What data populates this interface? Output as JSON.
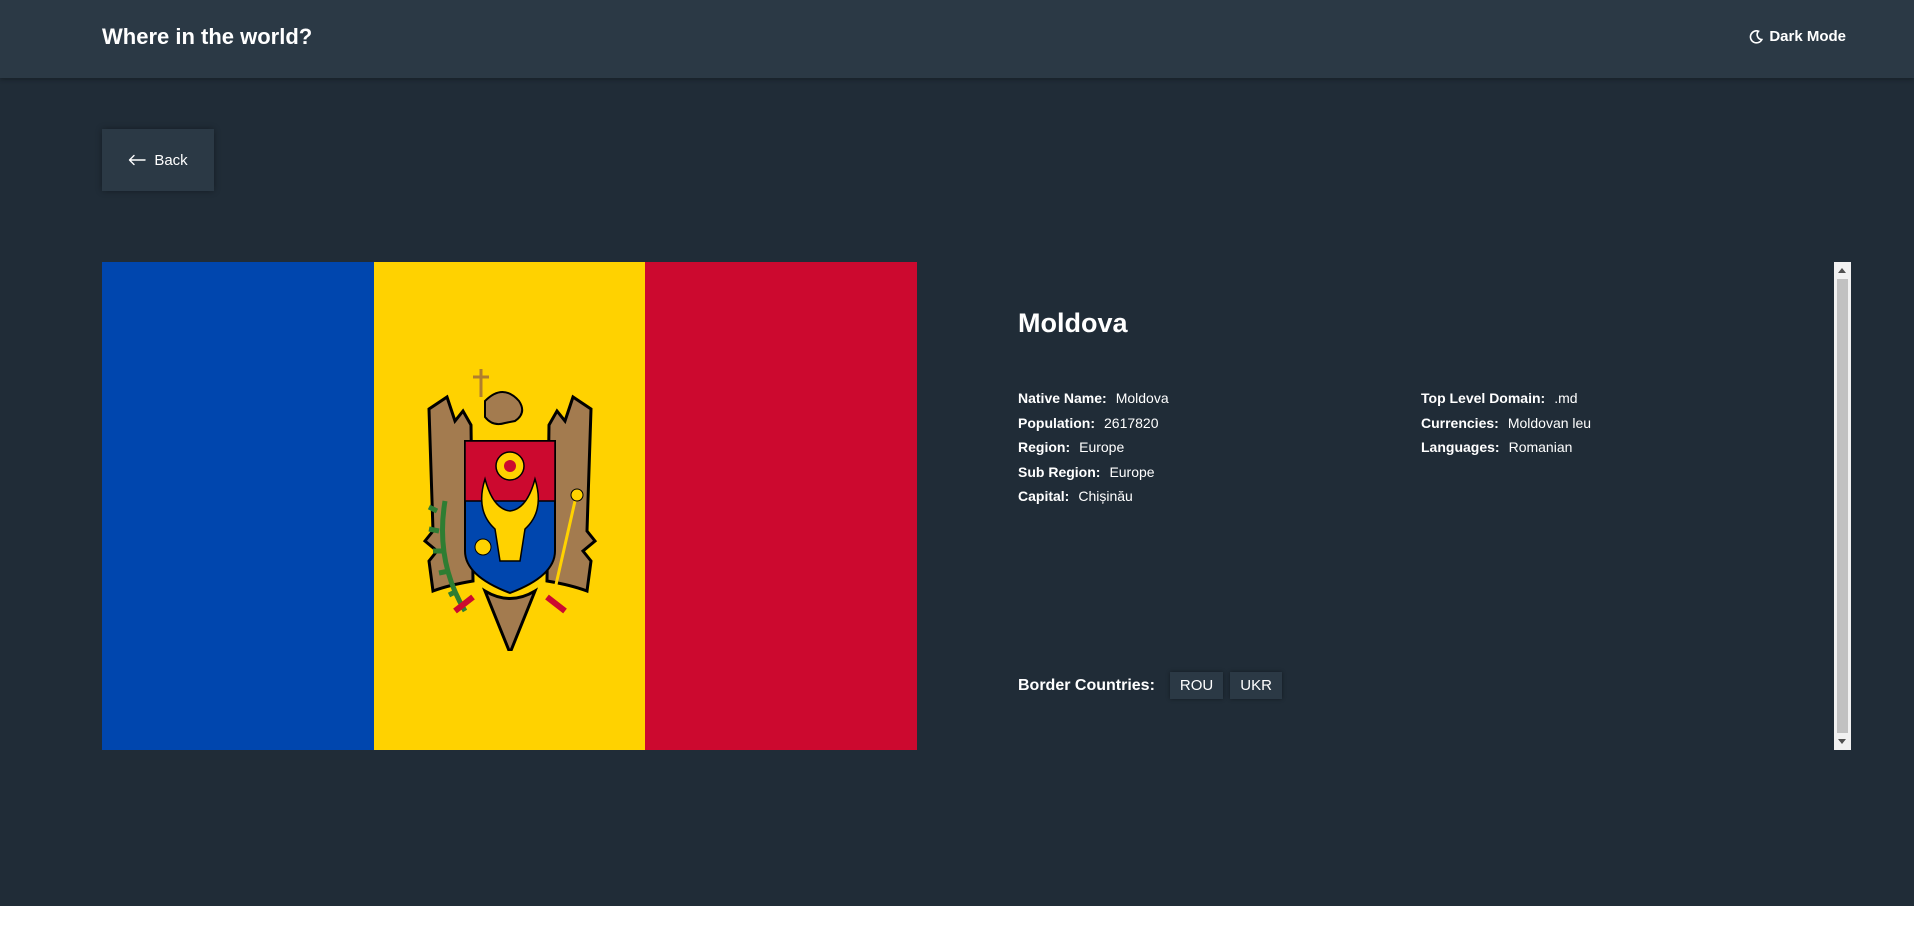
{
  "header": {
    "title": "Where in the world?",
    "theme_toggle_label": "Dark Mode",
    "theme_icon": "moon-icon"
  },
  "back_button": {
    "label": "Back",
    "icon": "arrow-left-icon"
  },
  "flag": {
    "country": "Moldova",
    "colors": [
      "#0046ae",
      "#ffd200",
      "#cc092f"
    ],
    "emblem": "coat-of-arms"
  },
  "country": {
    "name": "Moldova",
    "left_details": [
      {
        "label": "Native Name:",
        "value": "Moldova"
      },
      {
        "label": "Population:",
        "value": "2617820"
      },
      {
        "label": "Region:",
        "value": "Europe"
      },
      {
        "label": "Sub Region:",
        "value": "Europe"
      },
      {
        "label": "Capital:",
        "value": "Chișinău"
      }
    ],
    "right_details": [
      {
        "label": "Top Level Domain:",
        "value": ".md"
      },
      {
        "label": "Currencies:",
        "value": "Moldovan leu"
      },
      {
        "label": "Languages:",
        "value": "Romanian"
      }
    ],
    "border_title": "Border Countries:",
    "borders": [
      "ROU",
      "UKR"
    ]
  },
  "colors": {
    "background": "#202c37",
    "surface": "#2b3945",
    "text": "#ffffff"
  }
}
